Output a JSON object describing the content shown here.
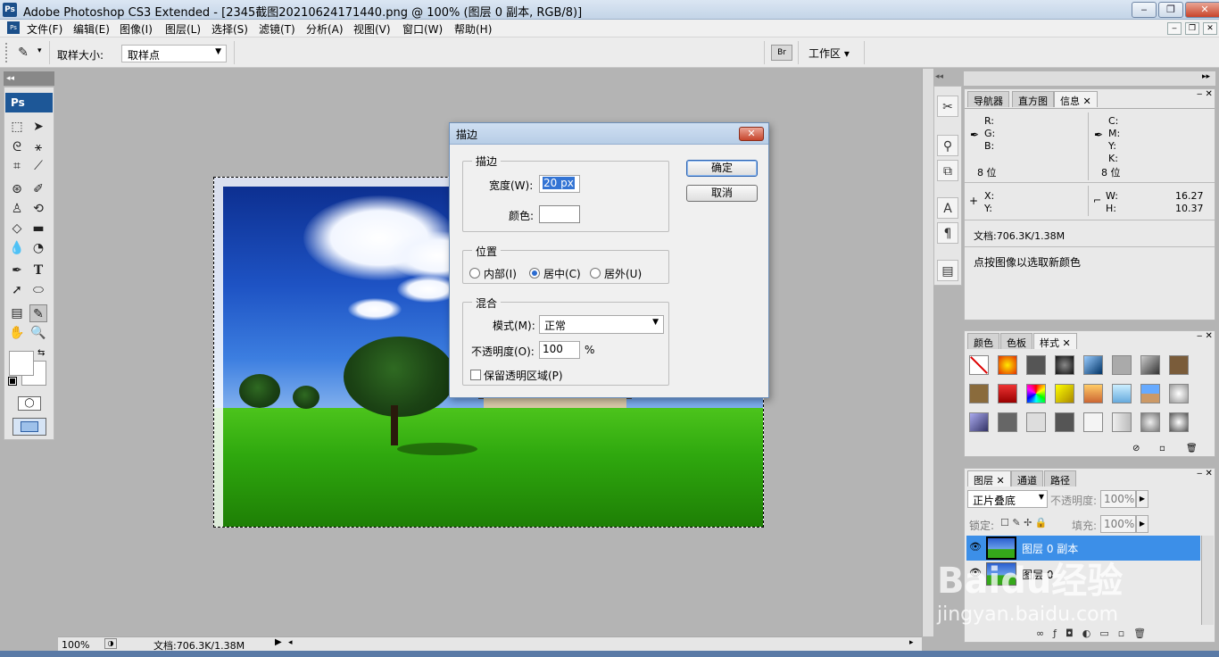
{
  "app": {
    "logo": "Ps",
    "title": "Adobe Photoshop CS3 Extended - [2345截图20210624171440.png @ 100% (图层 0 副本, RGB/8)]",
    "window_buttons": [
      "minimize-icon",
      "restore-icon",
      "close-icon"
    ]
  },
  "menu": {
    "items": [
      "文件(F)",
      "编辑(E)",
      "图像(I)",
      "图层(L)",
      "选择(S)",
      "滤镜(T)",
      "分析(A)",
      "视图(V)",
      "窗口(W)",
      "帮助(H)"
    ]
  },
  "options": {
    "sample_size_label": "取样大小:",
    "sample_size_value": "取样点",
    "workspace_label": "工作区 ▾"
  },
  "toolbox": {
    "logo": "Ps",
    "tools": [
      "marquee-icon",
      "move-icon",
      "lasso-icon",
      "magic-wand-icon",
      "crop-icon",
      "slice-icon",
      "healing-icon",
      "brush-icon",
      "stamp-icon",
      "history-brush-icon",
      "eraser-icon",
      "gradient-icon",
      "blur-icon",
      "dodge-icon",
      "pen-icon",
      "type-icon",
      "path-select-icon",
      "shape-icon",
      "notes-icon",
      "eyedropper-icon",
      "hand-icon",
      "zoom-icon"
    ],
    "selected_tool": "eyedropper-icon",
    "foreground_color": "#ffffff",
    "background_color": "#ffffff"
  },
  "status": {
    "zoom": "100%",
    "doc_info": "文档:706.3K/1.38M"
  },
  "info_panel": {
    "tabs": [
      "导航器",
      "直方图",
      "信息"
    ],
    "active_tab": "信息",
    "rgb_labels": [
      "R:",
      "G:",
      "B:"
    ],
    "cmyk_labels": [
      "C:",
      "M:",
      "Y:",
      "K:"
    ],
    "bit_left": "8 位",
    "bit_right": "8 位",
    "x_label": "X:",
    "y_label": "Y:",
    "w_label": "W:",
    "h_label": "H:",
    "w_value": "16.27",
    "h_value": "10.37",
    "doc_info": "文档:706.3K/1.38M",
    "hint": "点按图像以选取新颜色"
  },
  "styles_panel": {
    "tabs": [
      "颜色",
      "色板",
      "样式"
    ],
    "active_tab": "样式"
  },
  "layers_panel": {
    "tabs": [
      "图层",
      "通道",
      "路径"
    ],
    "active_tab": "图层",
    "blend_mode": "正片叠底",
    "opacity_label": "不透明度:",
    "opacity_value": "100%",
    "lock_label": "锁定:",
    "fill_label": "填充:",
    "fill_value": "100%",
    "layers": [
      {
        "name": "图层 0 副本",
        "selected": true
      },
      {
        "name": "图层 0",
        "selected": false
      }
    ]
  },
  "dialog": {
    "title": "描边",
    "stroke_group": "描边",
    "width_label": "宽度(W):",
    "width_value": "20 px",
    "color_label": "颜色:",
    "color_value": "#ffffff",
    "position_group": "位置",
    "position_options": [
      "内部(I)",
      "居中(C)",
      "居外(U)"
    ],
    "position_selected": "居中(C)",
    "blend_group": "混合",
    "mode_label": "模式(M):",
    "mode_value": "正常",
    "opacity_label": "不透明度(O):",
    "opacity_value": "100",
    "opacity_unit": "%",
    "preserve_label": "保留透明区域(P)",
    "preserve_checked": false,
    "ok_label": "确定",
    "cancel_label": "取消"
  },
  "watermark": {
    "text": "Baidu经验",
    "url": "jingyan.baidu.com"
  }
}
